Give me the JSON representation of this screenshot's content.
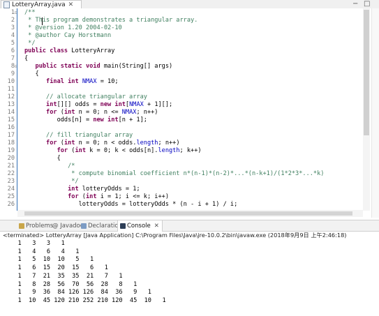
{
  "editor_tab": {
    "filename": "LotteryArray.java",
    "close_glyph": "✕"
  },
  "window_controls": {
    "minimize": "−",
    "maximize": "□"
  },
  "gutter": {
    "line_numbers": [
      "1",
      "2",
      "3",
      "4",
      "5",
      "6",
      "7",
      "8",
      "9",
      "10",
      "11",
      "12",
      "13",
      "14",
      "15",
      "16",
      "17",
      "18",
      "19",
      "20",
      "21",
      "22",
      "23",
      "24",
      "25",
      "26"
    ],
    "fold_markers": {
      "1": "⊟",
      "8": "⊟"
    }
  },
  "code_lines": [
    "/**",
    " * This program demonstrates a triangular array.",
    " * @version 1.20 2004-02-10",
    " * @author Cay Horstmann",
    " */",
    "public class LotteryArray",
    "{",
    "   public static void main(String[] args)",
    "   {",
    "      final int NMAX = 10;",
    "",
    "      // allocate triangular array",
    "      int[][] odds = new int[NMAX + 1][];",
    "      for (int n = 0; n <= NMAX; n++)",
    "         odds[n] = new int[n + 1];",
    "",
    "      // fill triangular array",
    "      for (int n = 0; n < odds.length; n++)",
    "         for (int k = 0; k < odds[n].length; k++)",
    "         {",
    "            /*",
    "             * compute binomial coefficient n*(n-1)*(n-2)*...*(n-k+1)/(1*2*3*...*k)",
    "             */",
    "            int lotteryOdds = 1;",
    "            for (int i = 1; i <= k; i++)",
    "               lotteryOdds = lotteryOdds * (n - i + 1) / i;"
  ],
  "views_tabs": [
    {
      "label": "Problems",
      "icon": "problems-icon",
      "active": false
    },
    {
      "label": "@ Javadoc",
      "icon": "javadoc-icon",
      "active": false
    },
    {
      "label": "Declaration",
      "icon": "declaration-icon",
      "active": false
    },
    {
      "label": "Console",
      "icon": "console-icon",
      "active": true
    }
  ],
  "console_tab_close": "✕",
  "console": {
    "status": "<terminated> LotteryArray [Java Application] C:\\Program Files\\Java\\jre-10.0.2\\bin\\javaw.exe (2018年9月9日 上午2:46:18)",
    "output_lines": [
      "   1   3   3   1",
      "   1   4   6   4   1",
      "   1   5  10  10   5   1",
      "   1   6  15  20  15   6   1",
      "   1   7  21  35  35  21   7   1",
      "   1   8  28  56  70  56  28   8   1",
      "   1   9  36  84 126 126  84  36   9   1",
      "   1  10  45 120 210 252 210 120  45  10   1"
    ]
  },
  "colors": {
    "keyword": "#7f0055",
    "comment": "#3f7f5f",
    "field": "#0000c0",
    "line_number": "#7a7a7a"
  }
}
